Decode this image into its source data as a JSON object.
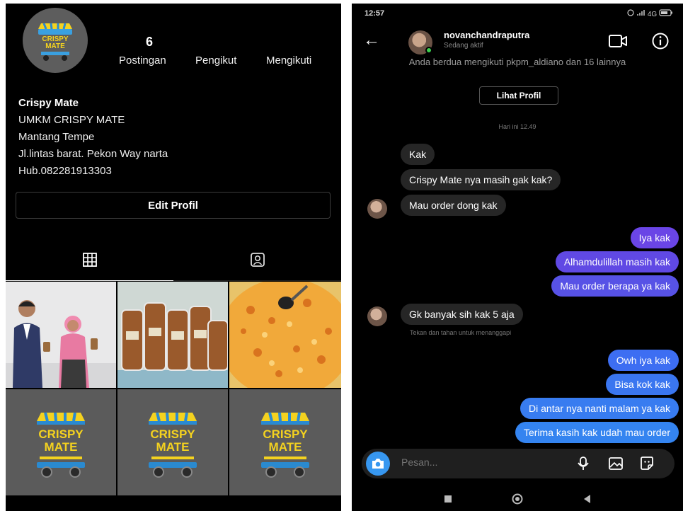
{
  "profile": {
    "stats": {
      "posts_count": "6",
      "posts_label": "Postingan",
      "followers_label": "Pengikut",
      "following_label": "Mengikuti"
    },
    "bio": {
      "name": "Crispy Mate",
      "line1": "UMKM CRISPY MATE",
      "line2": "Mantang Tempe",
      "line3": "Jl.lintas barat. Pekon Way narta",
      "line4": "Hub.082281913303"
    },
    "edit_button": "Edit Profil",
    "logo": {
      "line1": "CRISPY",
      "line2": "MATE"
    }
  },
  "chat": {
    "status_time": "12:57",
    "status_system": "4G",
    "username": "novanchandraputra",
    "status": "Sedang aktif",
    "mutual": "Anda berdua mengikuti pkpm_aldiano dan 16 lainnya",
    "view_profile": "Lihat Profil",
    "day_time": "Hari ini 12.49",
    "messages": [
      {
        "from": "them",
        "text": "Kak"
      },
      {
        "from": "them",
        "text": "Crispy Mate nya masih gak kak?"
      },
      {
        "from": "them",
        "text": "Mau order dong kak"
      },
      {
        "from": "me",
        "text": "Iya kak"
      },
      {
        "from": "me",
        "text": "Alhamdulillah masih kak"
      },
      {
        "from": "me",
        "text": "Mau order berapa ya kak"
      },
      {
        "from": "them",
        "text": "Gk banyak sih kak 5 aja"
      },
      {
        "from": "me",
        "text": "Owh iya kak"
      },
      {
        "from": "me",
        "text": "Bisa kok kak"
      },
      {
        "from": "me",
        "text": "Di antar nya nanti malam ya kak"
      },
      {
        "from": "me",
        "text": "Terima kasih kak udah mau order"
      }
    ],
    "hint": "Tekan dan tahan untuk menanggapi",
    "input_placeholder": "Pesan..."
  },
  "colors": {
    "bubble_purple": "#6f4fe3",
    "bubble_blue": "#3a7bf0",
    "accent_blue": "#3797f0",
    "logo_yellow": "#f4d21f"
  }
}
